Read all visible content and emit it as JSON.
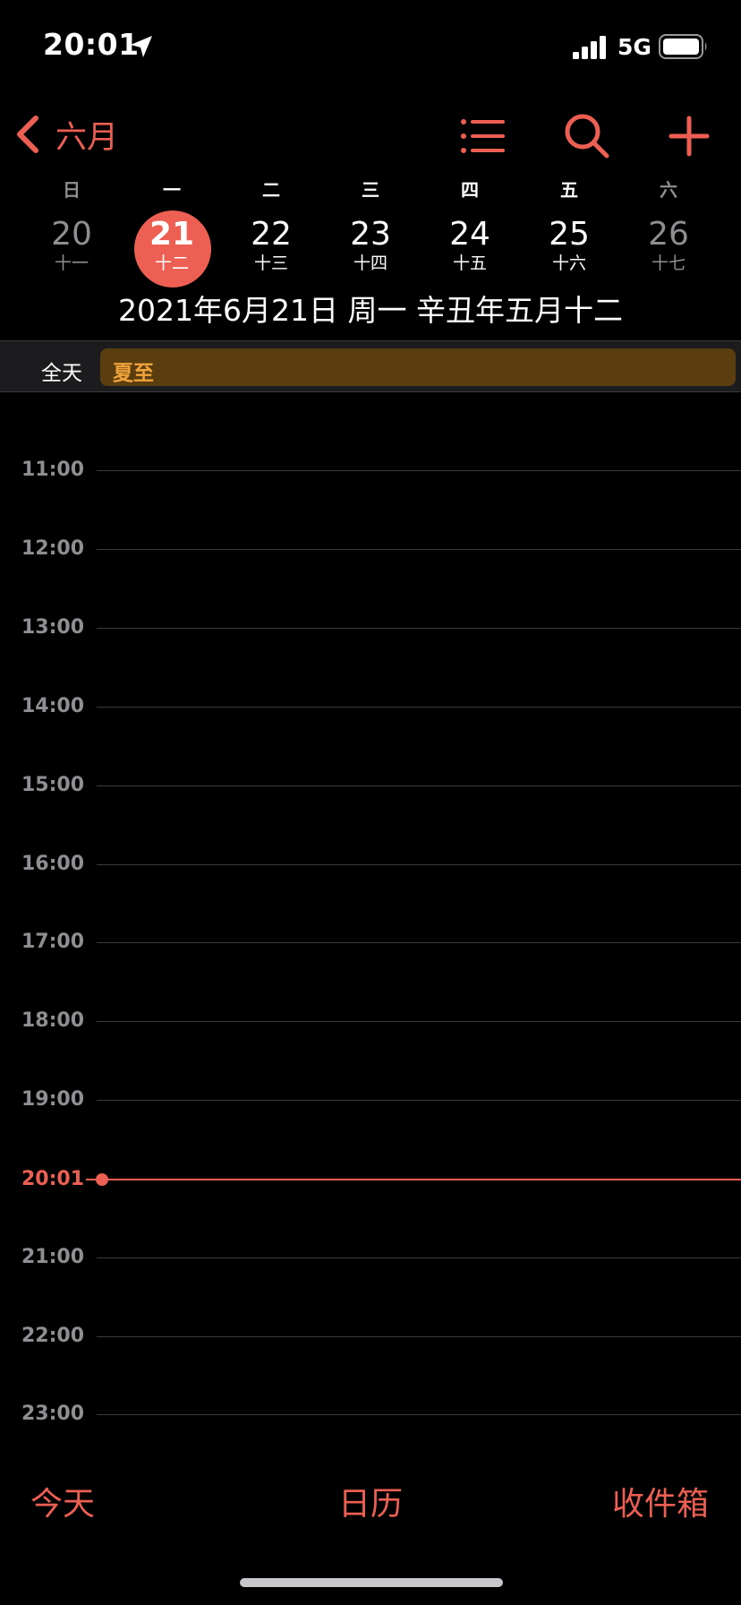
{
  "status_bar": {
    "time": "20:01",
    "network": "5G"
  },
  "nav": {
    "back_label": "六月"
  },
  "week": {
    "weekdays": [
      "日",
      "一",
      "二",
      "三",
      "四",
      "五",
      "六"
    ],
    "dates": [
      {
        "day": "20",
        "lunar": "十一"
      },
      {
        "day": "21",
        "lunar": "十二"
      },
      {
        "day": "22",
        "lunar": "十三"
      },
      {
        "day": "23",
        "lunar": "十四"
      },
      {
        "day": "24",
        "lunar": "十五"
      },
      {
        "day": "25",
        "lunar": "十六"
      },
      {
        "day": "26",
        "lunar": "十七"
      }
    ],
    "full_date": "2021年6月21日 周一   辛丑年五月十二"
  },
  "all_day": {
    "label": "全天",
    "event_title": "夏至"
  },
  "timeline": {
    "hours": [
      "11:00",
      "12:00",
      "13:00",
      "14:00",
      "15:00",
      "16:00",
      "17:00",
      "18:00",
      "19:00",
      "21:00",
      "22:00",
      "23:00"
    ],
    "now_label": "20:01"
  },
  "toolbar": {
    "today": "今天",
    "calendars": "日历",
    "inbox": "收件箱"
  },
  "colors": {
    "accent": "#ec5f52",
    "event_bg": "#5a3e0f",
    "event_text": "#f0a33a"
  }
}
